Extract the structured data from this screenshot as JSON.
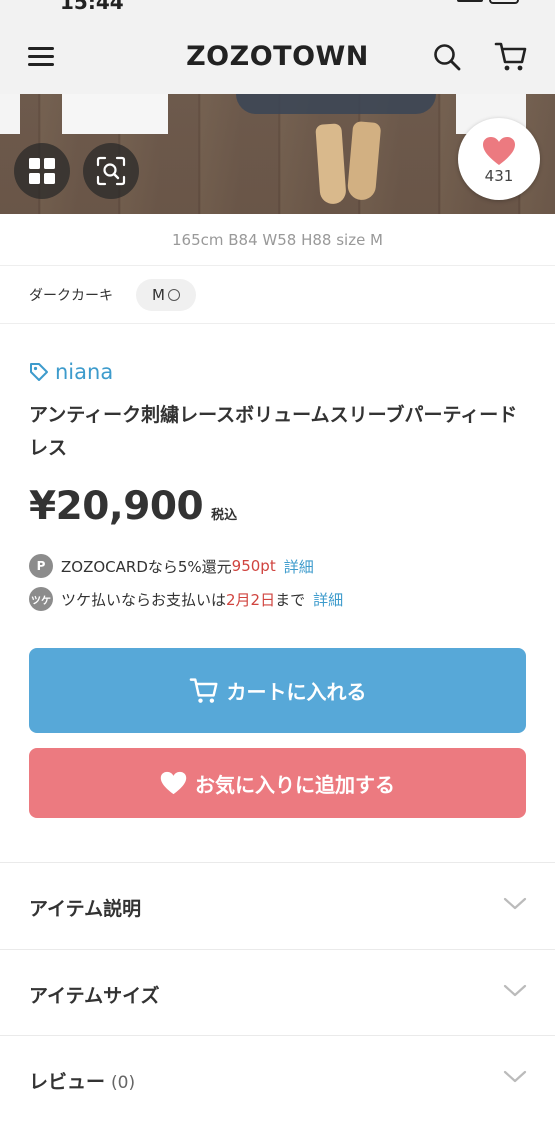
{
  "status_bar": {
    "time": "15:44"
  },
  "header": {
    "logo": "ZOZOTOWN"
  },
  "hero": {
    "favorite_count": "431"
  },
  "model_info": "165cm B84 W58 H88 size M",
  "variant": {
    "color": "ダークカーキ",
    "size": "M"
  },
  "product": {
    "brand": "niana",
    "title": "アンティーク刺繍レースボリュームスリーブパーティードレス",
    "price": "¥20,900",
    "tax_label": "税込"
  },
  "zozocard": {
    "badge": "P",
    "text": "ZOZOCARDなら5%還元",
    "points": "950pt",
    "link": "詳細"
  },
  "tsuke": {
    "badge": "ツケ",
    "text_before": "ツケ払いならお支払いは",
    "date": "2月2日",
    "text_after": "まで",
    "link": "詳細"
  },
  "actions": {
    "add_to_cart": "カートに入れる",
    "add_to_favorites": "お気に入りに追加する"
  },
  "accordions": [
    {
      "label": "アイテム説明"
    },
    {
      "label": "アイテムサイズ"
    },
    {
      "label": "レビュー",
      "count": "(0)"
    }
  ],
  "colors": {
    "brand_link": "#3d9bcc",
    "cart_button": "#57a8d8",
    "favorite_button": "#ec7a80",
    "accent_red": "#d0443f"
  }
}
